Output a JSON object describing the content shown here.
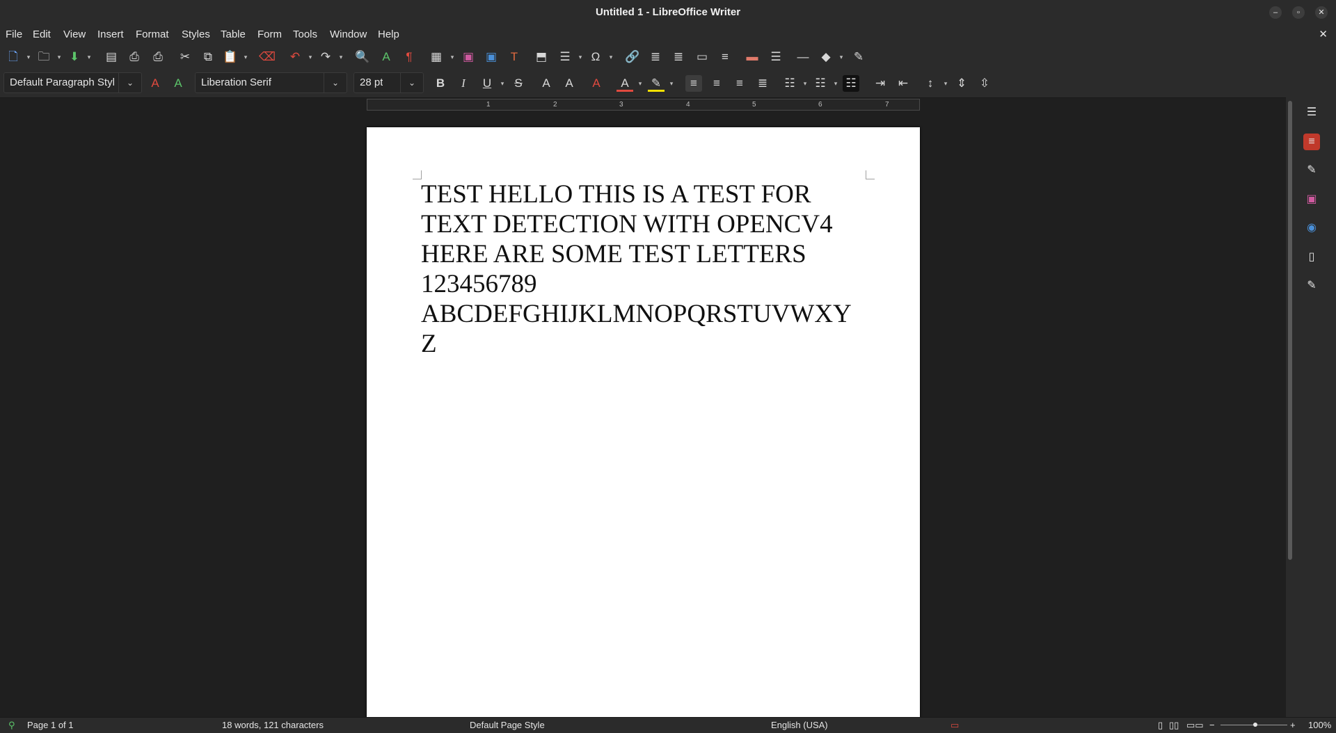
{
  "window": {
    "title": "Untitled 1 - LibreOffice Writer",
    "minimize": "–",
    "maximize": "▫",
    "close": "✕"
  },
  "menu": {
    "items": [
      "File",
      "Edit",
      "View",
      "Insert",
      "Format",
      "Styles",
      "Table",
      "Form",
      "Tools",
      "Window",
      "Help"
    ],
    "doc_close": "✕"
  },
  "toolbar": {
    "paragraph_style": "Default Paragraph Styl",
    "font_name": "Liberation Serif",
    "font_size": "28 pt"
  },
  "ruler": {
    "labels": [
      "1",
      "2",
      "3",
      "4",
      "5",
      "6",
      "7"
    ]
  },
  "document": {
    "lines": [
      "TEST HELLO THIS IS A TEST FOR",
      "TEXT DETECTION WITH OPENCV4",
      "HERE ARE SOME TEST LETTERS",
      "123456789",
      "ABCDEFGHIJKLMNOPQRSTUVWXY",
      "Z"
    ]
  },
  "statusbar": {
    "page": "Page 1 of 1",
    "word_count": "18 words, 121 characters",
    "page_style": "Default Page Style",
    "language": "English (USA)",
    "zoom": "100%"
  },
  "colors": {
    "accent_red": "#e04a3f",
    "highlight_yellow": "#f5e000",
    "sidebar_active": "#c0392b"
  }
}
